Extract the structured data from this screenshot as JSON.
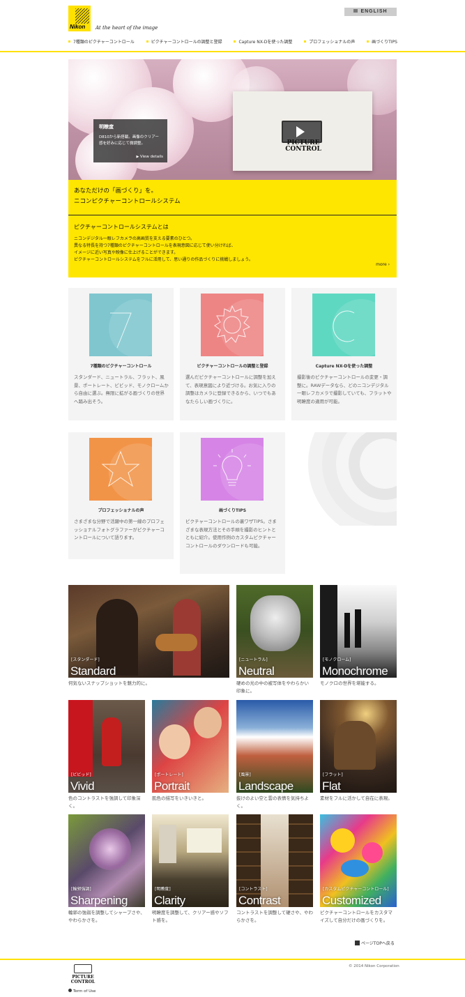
{
  "header": {
    "logo_text": "Nikon",
    "tagline": "At the heart of the image",
    "english_button": "ENGLISH",
    "nav": [
      {
        "label": "7種類のピクチャーコントロール"
      },
      {
        "label": "ピクチャーコントロールの調整と登録"
      },
      {
        "label": "Capture NX-Dを使った調整"
      },
      {
        "label": "プロフェッショナルの声"
      },
      {
        "label": "画づくりTIPS"
      }
    ]
  },
  "hero": {
    "caption_title": "明瞭度",
    "caption_text": "D810から新搭載。画像のクリアー感を好みに応じて微調整。",
    "view_details": "View details",
    "product_logo_line1": "PICTURE",
    "product_logo_line2": "CONTROL"
  },
  "intro": {
    "headline_line1": "あなただけの「画づくり」を。",
    "headline_line2": "ニコンピクチャーコントロールシステム",
    "subhead": "ピクチャーコントロールシステムとは",
    "desc_lines": [
      "ニコンデジタル一眼レフカメラの高画質を支える要素のひとつ。",
      "異なる特長を持つ7種類のピクチャーコントロールを表現意図に応じて使い分ければ、",
      "イメージに近い写真や映像に仕上げることができます。",
      "ピクチャーコントロールシステムをフルに活用して、思い通りの作品づくりに挑戦しましょう。"
    ],
    "more": "more ›"
  },
  "cards": [
    {
      "title": "7種類のピクチャーコントロール",
      "desc": "スタンダード、ニュートラル、フラット、風景、ポートレート、ビビッド、モノクロームから自由に選ぶ。無限に拡がる画づくりの世界へ踏み出そう。",
      "color": "#7fc6cf",
      "icon": "seven-icon"
    },
    {
      "title": "ピクチャーコントロールの調整と登録",
      "desc": "選んだピクチャーコントロールに調整を加えて、表現意図により近づける。お気に入りの調整はカメラに登録できるから、いつでもあなたらしい画づくりに。",
      "color": "#ee8585",
      "icon": "gear-icon"
    },
    {
      "title": "Capture NX-Dを使った調整",
      "desc": "撮影後のピクチャーコントロールの変更・調整に。RAWデータなら、どのニコンデジタル一眼レフカメラで撮影していても、フラットや明瞭度の適用が可能。",
      "color": "#5fd8c2",
      "icon": "c-icon"
    },
    {
      "title": "プロフェッショナルの声",
      "desc": "さまざまな分野で活躍中の第一線のプロフェッショナルフォトグラファーがピクチャーコントロールについて語ります。",
      "color": "#f29448",
      "icon": "star-icon"
    },
    {
      "title": "画づくりTIPS",
      "desc": "ピクチャーコントロールの裏ワザTIPS。さまざまな表現方法とその手順を撮影のヒントとともに紹介。使用作例のカスタムピクチャーコントロールのダウンロードも可能。",
      "color": "#d685e6",
      "icon": "lightbulb-icon"
    }
  ],
  "styles": [
    {
      "jp": "[スタンダード]",
      "en": "Standard",
      "desc": "何気ないスナップショットを魅力的に。"
    },
    {
      "jp": "[ニュートラル]",
      "en": "Neutral",
      "desc": "硬めの光の中の被写体をやわらかい印象に。"
    },
    {
      "jp": "[モノクローム]",
      "en": "Monochrome",
      "desc": "モノクロの世界を堪能する。"
    },
    {
      "jp": "[ビビッド]",
      "en": "Vivid",
      "desc": "色のコントラストを強調して印象深く。"
    },
    {
      "jp": "[ポートレート]",
      "en": "Portrait",
      "desc": "肌色の描写をいきいきと。"
    },
    {
      "jp": "[風景]",
      "en": "Landscape",
      "desc": "抜けのよい空と雲の表情を気持ちよく。"
    },
    {
      "jp": "[フラット]",
      "en": "Flat",
      "desc": "素材をフルに活かして自在に表現。"
    },
    {
      "jp": "[輪郭強調]",
      "en": "Sharpening",
      "desc": "輪郭の強弱を調整してシャープさや、やわらかさを。"
    },
    {
      "jp": "[明瞭度]",
      "en": "Clarity",
      "desc": "明瞭度を調整して、クリアー感やソフト感を。"
    },
    {
      "jp": "[コントラスト]",
      "en": "Contrast",
      "desc": "コントラストを調整して硬さや、やわらかさを。"
    },
    {
      "jp": "[カスタムピクチャーコントロール]",
      "en": "Customized",
      "desc": "ピクチャーコントロールをカスタマイズして自分だけの画づくりを。"
    }
  ],
  "footer": {
    "page_top": "ページTOPへ戻る",
    "logo_line1": "PICTURE",
    "logo_line2": "CONTROL",
    "terms": "Term of Use",
    "copyright": "© 2014 Nikon Corporation"
  }
}
